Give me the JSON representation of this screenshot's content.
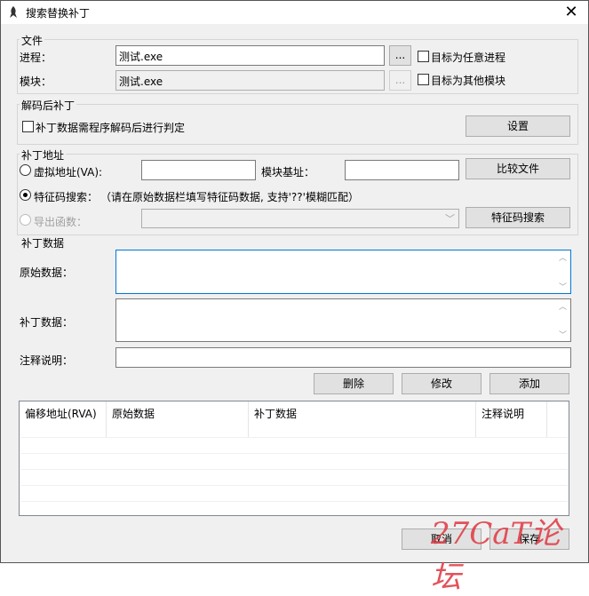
{
  "window": {
    "title": "搜索替换补丁",
    "close_glyph": "✕"
  },
  "file_group": {
    "label": "文件",
    "process_label": "进程：",
    "process_value": "测试.exe",
    "module_label": "模块：",
    "module_value": "测试.exe",
    "browse_label": "...",
    "any_process_label": "目标为任意进程",
    "other_module_label": "目标为其他模块"
  },
  "decode_group": {
    "label": "解码后补丁",
    "check_label": "补丁数据需程序解码后进行判定",
    "settings_button": "设置"
  },
  "address_group": {
    "label": "补丁地址",
    "va_label": "虚拟地址(VA):",
    "base_label": "模块基址：",
    "compare_button": "比较文件",
    "sig_label": "特征码搜索：",
    "sig_hint": "（请在原始数据栏填写特征码数据, 支持'??'模糊匹配）",
    "export_label": "导出函数：",
    "sig_search_button": "特征码搜索"
  },
  "patch_group": {
    "label": "补丁数据",
    "original_label": "原始数据：",
    "patch_label": "补丁数据：",
    "comment_label": "注释说明：",
    "delete_button": "删除",
    "modify_button": "修改",
    "add_button": "添加"
  },
  "table": {
    "columns": [
      "偏移地址(RVA)",
      "原始数据",
      "补丁数据",
      "注释说明"
    ]
  },
  "footer": {
    "cancel_button": "取消",
    "save_button": "保存"
  },
  "watermark": "27CaT论坛",
  "colors": {
    "accent": "#0078d7",
    "watermark": "#e0404a"
  }
}
